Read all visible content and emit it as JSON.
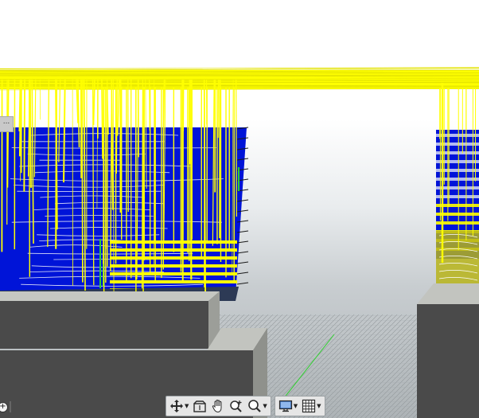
{
  "window": {
    "title": ""
  },
  "corner_tab": {
    "label": "..."
  },
  "left_widget": {
    "icon": "add-circle-icon"
  },
  "navigation_toolbar": {
    "groups": [
      {
        "tools": [
          {
            "id": "pan-orbit",
            "icon": "move-arrows-icon",
            "has_menu": true
          },
          {
            "id": "look-at",
            "icon": "view-box-icon",
            "has_menu": false
          },
          {
            "id": "pan",
            "icon": "hand-icon",
            "has_menu": false
          },
          {
            "id": "zoom-plus",
            "icon": "zoom-in-icon",
            "has_menu": false
          },
          {
            "id": "zoom",
            "icon": "zoom-magnifier-icon",
            "has_menu": true
          }
        ]
      },
      {
        "tools": [
          {
            "id": "display",
            "icon": "monitor-icon",
            "has_menu": true
          },
          {
            "id": "grid",
            "icon": "grid-icon",
            "has_menu": true
          }
        ]
      }
    ]
  },
  "colors": {
    "path_yellow": "#ffff00",
    "layer_blue": "#0014d8",
    "wall_dark": "#4a4a4a",
    "wall_edge": "#b9bbb5",
    "support_green": "#2fd12f",
    "background_top": "#ffffff",
    "background_bottom": "#aeb4b7"
  }
}
